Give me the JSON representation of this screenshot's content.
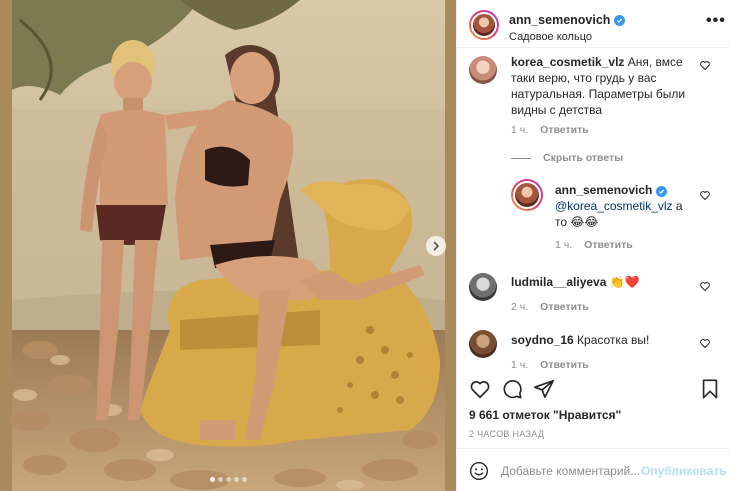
{
  "post": {
    "username": "ann_semenovich",
    "location": "Садовое кольцо",
    "verified": true,
    "more_glyph": "•••"
  },
  "photo": {
    "alt": "",
    "slides_total": 5,
    "active_slide": 1
  },
  "comments": [
    {
      "user": "korea_cosmetik_vlz",
      "text": "Аня, вмсе таки верю, что грудь у вас натуральная. Параметры были видны с детства",
      "time": "1 ч.",
      "reply_label": "Ответить"
    },
    {
      "is_reply": true,
      "user": "ann_semenovich",
      "mention": "@korea_cosmetik_vlz",
      "text": "а то 😂😂",
      "time": "1 ч.",
      "reply_label": "Ответить"
    },
    {
      "user": "ludmila__aliyeva",
      "text": "👏❤️",
      "time": "2 ч.",
      "reply_label": "Ответить"
    },
    {
      "user": "soydno_16",
      "text": "Красотка вы!",
      "time": "1 ч.",
      "reply_label": "Ответить"
    }
  ],
  "hide_replies_label": "Скрыть ответы",
  "likes_text": "9 661 отметок \"Нравится\"",
  "time_ago": "2 ЧАСОВ НАЗАД",
  "composer": {
    "placeholder": "Добавьте комментарий...",
    "publish_label": "Опубликовать"
  },
  "colors": {
    "accent": "#3897f0",
    "publish_disabled": "#b2dffc",
    "muted": "#8e8e8e",
    "text": "#262626"
  },
  "icons": [
    "heart-icon",
    "comment-icon",
    "share-icon",
    "bookmark-icon",
    "emoji-icon",
    "chevron-right-icon",
    "verified-icon",
    "more-icon"
  ]
}
